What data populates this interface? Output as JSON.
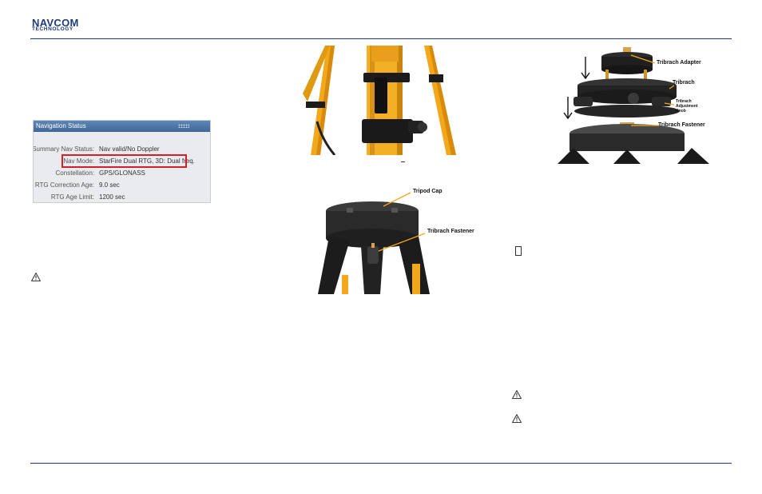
{
  "header": {
    "logo_line1": "NAVCOM",
    "logo_line2": "TECHNOLOGY"
  },
  "nav_status_panel": {
    "title": "Navigation Status",
    "rows": [
      {
        "label": "Summary Nav Status:",
        "value": "Nav valid/No Doppler"
      },
      {
        "label": "Nav Mode:",
        "value": "StarFire Dual RTG, 3D: Dual freq."
      },
      {
        "label": "Constellation:",
        "value": "GPS/GLONASS"
      },
      {
        "label": "RTG Correction Age:",
        "value": "9.0 sec"
      },
      {
        "label": "RTG Age Limit:",
        "value": "1200 sec"
      }
    ],
    "highlight_color": "#d61f26"
  },
  "figures": {
    "tribrach_labels": {
      "adapter": "Tribrach Adapter",
      "tribrach": "Tribrach",
      "adjustment_knob_1": "Tribrach",
      "adjustment_knob_2": "Adjustment",
      "adjustment_knob_3": "Knob",
      "fastener": "Tribrach Fastener"
    },
    "tripod_cap_labels": {
      "cap": "Tripod Cap",
      "fastener": "Tribrach Fastener"
    }
  },
  "icons": [
    "warning-icon",
    "note-icon"
  ],
  "colors": {
    "brand_blue": "#1e3a7a",
    "tripod_yellow": "#f2a81a"
  }
}
